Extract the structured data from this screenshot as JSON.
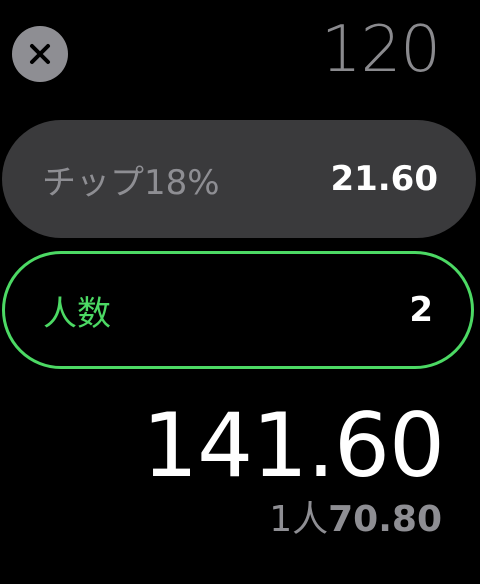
{
  "header": {
    "close_icon": "close-icon",
    "bill_amount": "120"
  },
  "tip": {
    "label": "チップ18%",
    "value": "21.60"
  },
  "people": {
    "label": "人数",
    "value": "2"
  },
  "total": {
    "value": "141.60"
  },
  "per_person": {
    "label": "1人",
    "value": "70.80"
  },
  "colors": {
    "accent": "#4cd964",
    "pill_background": "#3a3a3c",
    "secondary_text": "#8e8e93"
  }
}
